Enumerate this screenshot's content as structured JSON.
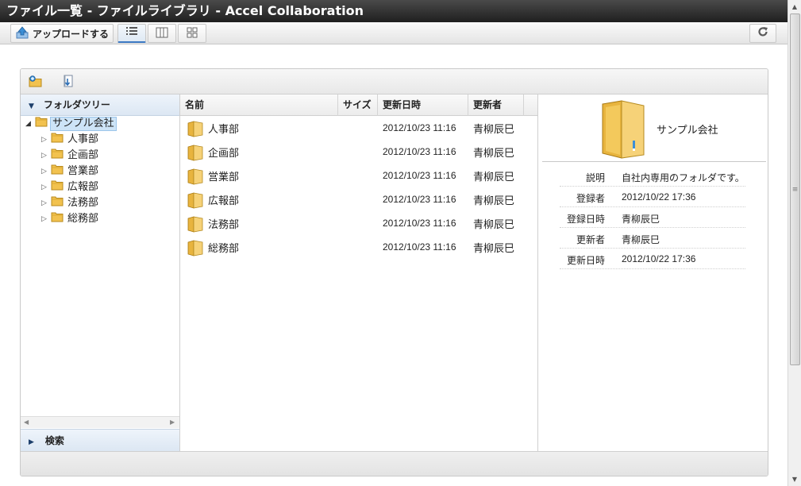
{
  "window": {
    "title": "ファイル一覧 - ファイルライブラリ - Accel Collaboration"
  },
  "toolbar": {
    "upload_label": "アップロードする",
    "upload_icon": "upload-icon",
    "view_modes": [
      "list-view-icon",
      "column-view-icon",
      "thumbnail-view-icon"
    ],
    "active_view": "list-view-icon",
    "refresh_icon": "refresh-icon"
  },
  "panel_actions": [
    "new-folder-icon",
    "upload-file-icon"
  ],
  "sidebar": {
    "tree_header": "フォルダツリー",
    "root": {
      "label": "サンプル会社",
      "expanded": true,
      "selected": true
    },
    "children": [
      {
        "label": "人事部"
      },
      {
        "label": "企画部"
      },
      {
        "label": "営業部"
      },
      {
        "label": "広報部"
      },
      {
        "label": "法務部"
      },
      {
        "label": "総務部"
      }
    ],
    "search_header": "検索"
  },
  "file_list": {
    "columns": {
      "name": "名前",
      "size": "サイズ",
      "updated_at": "更新日時",
      "updated_by": "更新者"
    },
    "rows": [
      {
        "name": "人事部",
        "size": "",
        "updated_at": "2012/10/23 11:16",
        "updated_by": "青柳辰巳"
      },
      {
        "name": "企画部",
        "size": "",
        "updated_at": "2012/10/23 11:16",
        "updated_by": "青柳辰巳"
      },
      {
        "name": "営業部",
        "size": "",
        "updated_at": "2012/10/23 11:16",
        "updated_by": "青柳辰巳"
      },
      {
        "name": "広報部",
        "size": "",
        "updated_at": "2012/10/23 11:16",
        "updated_by": "青柳辰巳"
      },
      {
        "name": "法務部",
        "size": "",
        "updated_at": "2012/10/23 11:16",
        "updated_by": "青柳辰巳"
      },
      {
        "name": "総務部",
        "size": "",
        "updated_at": "2012/10/23 11:16",
        "updated_by": "青柳辰巳"
      }
    ]
  },
  "details": {
    "name": "サンプル会社",
    "properties": [
      {
        "key": "説明",
        "value": "自社内専用のフォルダです。"
      },
      {
        "key": "登録者",
        "value": "2012/10/22 17:36"
      },
      {
        "key": "登録日時",
        "value": "青柳辰巳"
      },
      {
        "key": "更新者",
        "value": "青柳辰巳"
      },
      {
        "key": "更新日時",
        "value": "2012/10/22 17:36"
      }
    ]
  },
  "colors": {
    "folder": "#f2c24f",
    "header_blue": "#dce7f3",
    "selection": "#cde4f7",
    "title_bar": "#2b2b2b"
  }
}
